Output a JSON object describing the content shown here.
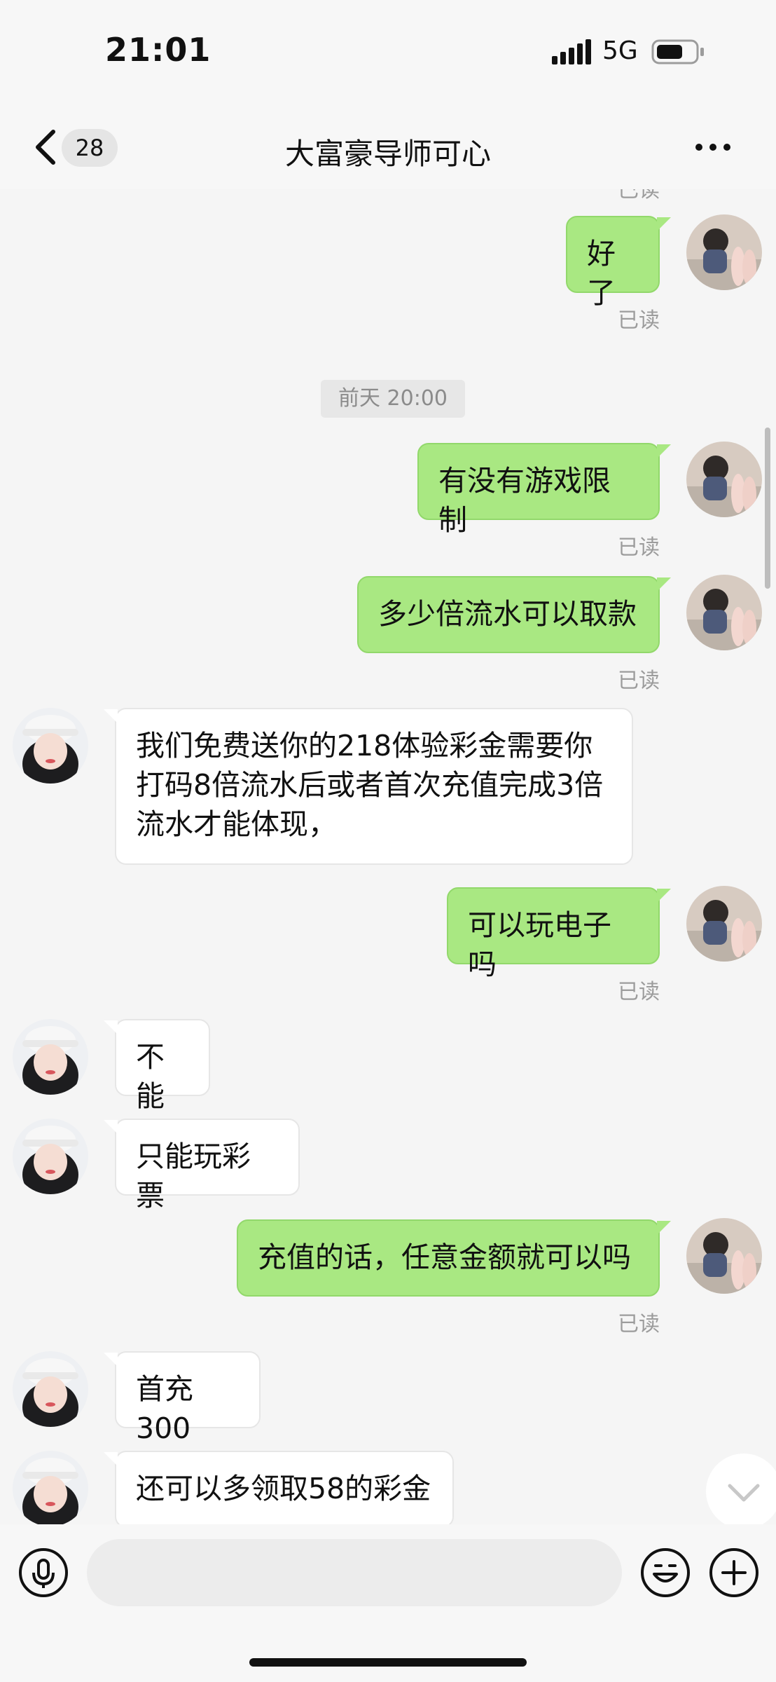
{
  "status": {
    "time": "21:01",
    "network": "5G"
  },
  "header": {
    "back_count": "28",
    "title": "大富豪导师可心"
  },
  "chat": {
    "top_read_partial": "已读",
    "timestamp": "前天 20:00",
    "messages": [
      {
        "side": "out",
        "text": "好了",
        "read": "已读"
      },
      {
        "side": "out",
        "text": "有没有游戏限制",
        "read": "已读"
      },
      {
        "side": "out",
        "text": "多少倍流水可以取款",
        "read": "已读"
      },
      {
        "side": "in",
        "text": "我们免费送你的218体验彩金需要你打码8倍流水后或者首次充值完成3倍流水才能体现，"
      },
      {
        "side": "out",
        "text": "可以玩电子吗",
        "read": "已读"
      },
      {
        "side": "in",
        "text": "不能"
      },
      {
        "side": "in",
        "text": "只能玩彩票"
      },
      {
        "side": "out",
        "text": "充值的话，任意金额就可以吗",
        "read": "已读"
      },
      {
        "side": "in",
        "text": "首充300"
      },
      {
        "side": "in",
        "text": "还可以多领取58的彩金"
      }
    ]
  },
  "colors": {
    "outgoing_bubble": "#a9e882",
    "incoming_bubble": "#ffffff",
    "background": "#f5f5f5"
  },
  "icons": [
    "back-chevron-icon",
    "more-icon",
    "scroll-down-icon",
    "microphone-icon",
    "emoji-icon",
    "plus-icon"
  ]
}
